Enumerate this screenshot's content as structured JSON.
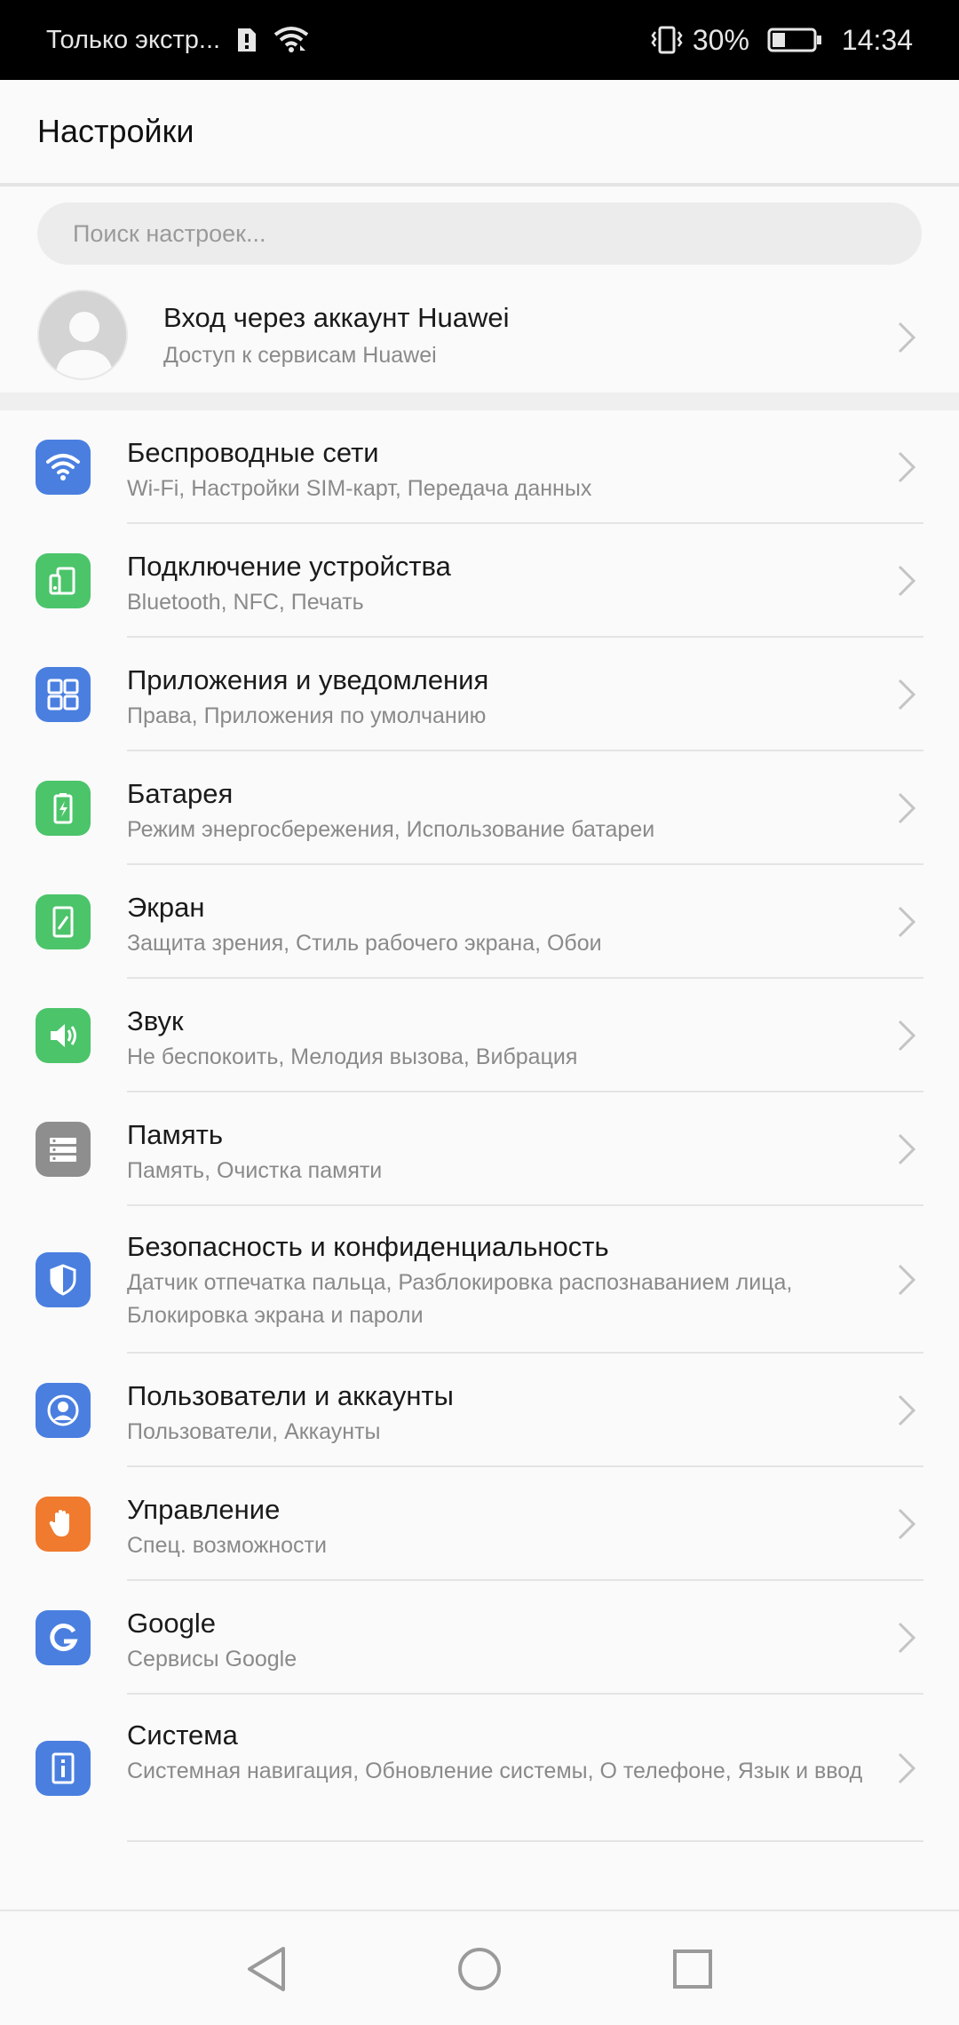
{
  "status_bar": {
    "carrier_text": "Только экстр...",
    "battery_percent": "30%",
    "time": "14:34",
    "icons": [
      "sim-alert-icon",
      "wifi-icon",
      "vibrate-icon",
      "battery-icon"
    ]
  },
  "header": {
    "title": "Настройки"
  },
  "search": {
    "placeholder": "Поиск настроек..."
  },
  "account": {
    "title": "Вход через аккаунт Huawei",
    "subtitle": "Доступ к сервисам Huawei"
  },
  "settings": [
    {
      "title": "Беспроводные сети",
      "subtitle": "Wi-Fi, Настройки SIM-карт, Передача данных",
      "icon": "wifi-icon",
      "color": "#4a7fe0"
    },
    {
      "title": "Подключение устройства",
      "subtitle": "Bluetooth, NFC, Печать",
      "icon": "device-connection-icon",
      "color": "#4cc46a"
    },
    {
      "title": "Приложения и уведомления",
      "subtitle": "Права, Приложения по умолчанию",
      "icon": "apps-grid-icon",
      "color": "#4a7fe0"
    },
    {
      "title": "Батарея",
      "subtitle": "Режим энергосбережения, Использование батареи",
      "icon": "battery-icon",
      "color": "#4cc46a"
    },
    {
      "title": "Экран",
      "subtitle": "Защита зрения, Стиль рабочего экрана, Обои",
      "icon": "display-icon",
      "color": "#4cc46a"
    },
    {
      "title": "Звук",
      "subtitle": "Не беспокоить, Мелодия вызова, Вибрация",
      "icon": "sound-icon",
      "color": "#4cc46a"
    },
    {
      "title": "Память",
      "subtitle": "Память, Очистка памяти",
      "icon": "storage-icon",
      "color": "#8e8e8e"
    },
    {
      "title": "Безопасность и конфиденциальность",
      "subtitle": "Датчик отпечатка пальца, Разблокировка распознаванием лица, Блокировка экрана и пароли",
      "icon": "shield-icon",
      "color": "#4a7fe0"
    },
    {
      "title": "Пользователи и аккаунты",
      "subtitle": "Пользователи, Аккаунты",
      "icon": "user-icon",
      "color": "#4a7fe0"
    },
    {
      "title": "Управление",
      "subtitle": "Спец. возможности",
      "icon": "hand-icon",
      "color": "#f07a2e"
    },
    {
      "title": "Google",
      "subtitle": "Сервисы Google",
      "icon": "google-icon",
      "color": "#4a7fe0"
    },
    {
      "title": "Система",
      "subtitle": "Системная навигация, Обновление системы, О телефоне, Язык и ввод",
      "icon": "system-info-icon",
      "color": "#4a7fe0"
    }
  ],
  "nav": {
    "icons": [
      "back-icon",
      "home-icon",
      "recents-icon"
    ]
  }
}
